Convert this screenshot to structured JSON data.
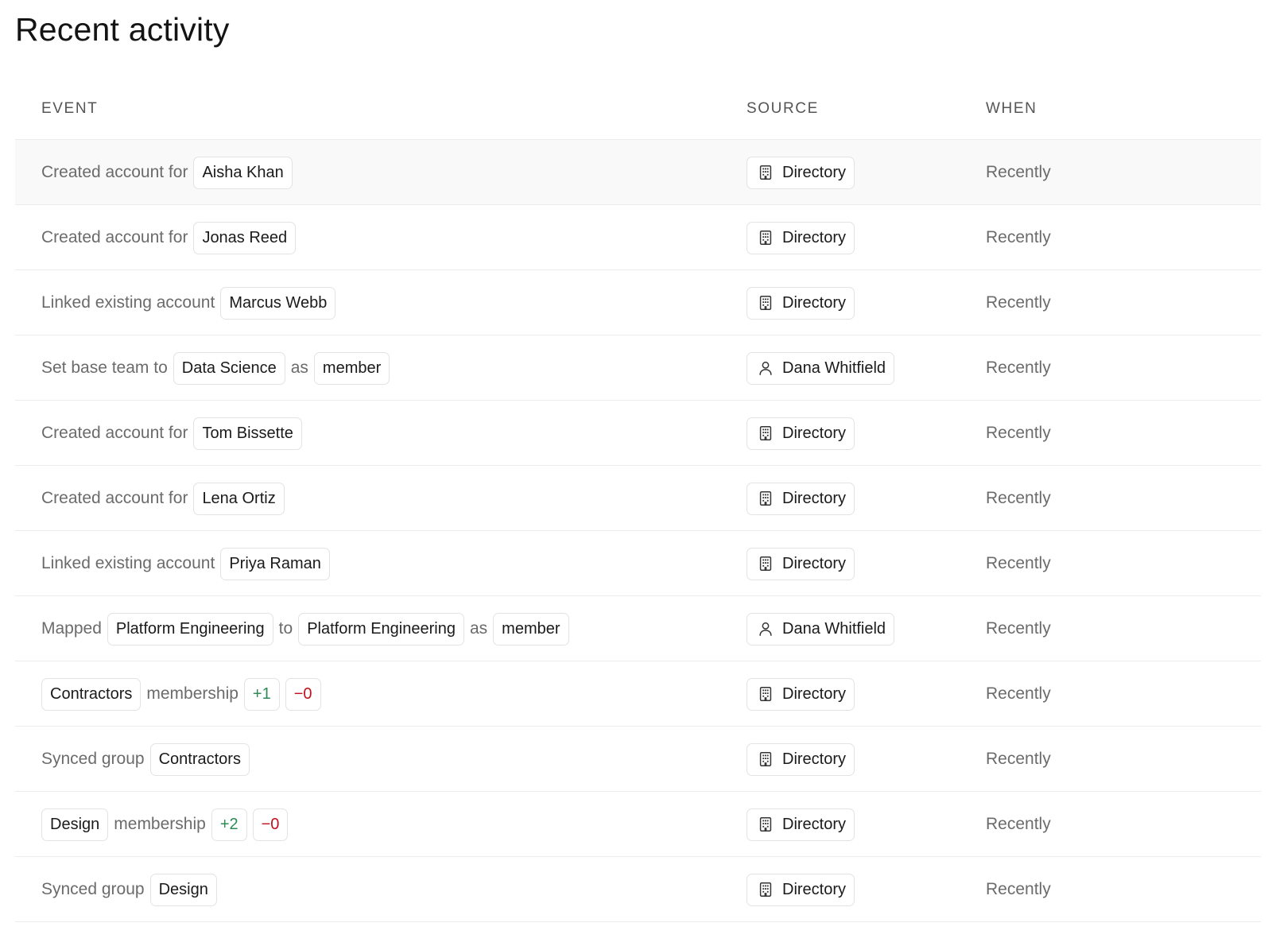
{
  "page": {
    "title": "Recent activity"
  },
  "table": {
    "headers": {
      "event": "EVENT",
      "source": "SOURCE",
      "when": "WHEN"
    },
    "rows": [
      {
        "parts": [
          {
            "t": "text",
            "v": "Created account for"
          },
          {
            "t": "chip",
            "v": "Aisha Khan"
          }
        ],
        "source": {
          "icon": "building-icon",
          "label": "Directory"
        },
        "when": "Recently"
      },
      {
        "parts": [
          {
            "t": "text",
            "v": "Created account for"
          },
          {
            "t": "chip",
            "v": "Jonas Reed"
          }
        ],
        "source": {
          "icon": "building-icon",
          "label": "Directory"
        },
        "when": "Recently"
      },
      {
        "parts": [
          {
            "t": "text",
            "v": "Linked existing account"
          },
          {
            "t": "chip",
            "v": "Marcus Webb"
          }
        ],
        "source": {
          "icon": "building-icon",
          "label": "Directory"
        },
        "when": "Recently"
      },
      {
        "parts": [
          {
            "t": "text",
            "v": "Set base team to"
          },
          {
            "t": "chip",
            "v": "Data Science"
          },
          {
            "t": "text",
            "v": "as"
          },
          {
            "t": "chip",
            "v": "member"
          }
        ],
        "source": {
          "icon": "user-icon",
          "label": "Dana Whitfield"
        },
        "when": "Recently"
      },
      {
        "parts": [
          {
            "t": "text",
            "v": "Created account for"
          },
          {
            "t": "chip",
            "v": "Tom Bissette"
          }
        ],
        "source": {
          "icon": "building-icon",
          "label": "Directory"
        },
        "when": "Recently"
      },
      {
        "parts": [
          {
            "t": "text",
            "v": "Created account for"
          },
          {
            "t": "chip",
            "v": "Lena Ortiz"
          }
        ],
        "source": {
          "icon": "building-icon",
          "label": "Directory"
        },
        "when": "Recently"
      },
      {
        "parts": [
          {
            "t": "text",
            "v": "Linked existing account"
          },
          {
            "t": "chip",
            "v": "Priya Raman"
          }
        ],
        "source": {
          "icon": "building-icon",
          "label": "Directory"
        },
        "when": "Recently"
      },
      {
        "parts": [
          {
            "t": "text",
            "v": "Mapped"
          },
          {
            "t": "chip",
            "v": "Platform Engineering"
          },
          {
            "t": "text",
            "v": "to"
          },
          {
            "t": "chip",
            "v": "Platform Engineering"
          },
          {
            "t": "text",
            "v": "as"
          },
          {
            "t": "chip",
            "v": "member"
          }
        ],
        "source": {
          "icon": "user-icon",
          "label": "Dana Whitfield"
        },
        "when": "Recently"
      },
      {
        "parts": [
          {
            "t": "chip",
            "v": "Contractors"
          },
          {
            "t": "text",
            "v": "membership"
          },
          {
            "t": "plus",
            "v": "+1"
          },
          {
            "t": "minus",
            "v": "−0"
          }
        ],
        "source": {
          "icon": "building-icon",
          "label": "Directory"
        },
        "when": "Recently"
      },
      {
        "parts": [
          {
            "t": "text",
            "v": "Synced group"
          },
          {
            "t": "chip",
            "v": "Contractors"
          }
        ],
        "source": {
          "icon": "building-icon",
          "label": "Directory"
        },
        "when": "Recently"
      },
      {
        "parts": [
          {
            "t": "chip",
            "v": "Design"
          },
          {
            "t": "text",
            "v": "membership"
          },
          {
            "t": "plus",
            "v": "+2"
          },
          {
            "t": "minus",
            "v": "−0"
          }
        ],
        "source": {
          "icon": "building-icon",
          "label": "Directory"
        },
        "when": "Recently"
      },
      {
        "parts": [
          {
            "t": "text",
            "v": "Synced group"
          },
          {
            "t": "chip",
            "v": "Design"
          }
        ],
        "source": {
          "icon": "building-icon",
          "label": "Directory"
        },
        "when": "Recently"
      }
    ]
  },
  "colors": {
    "positive": "#2e8b57",
    "negative": "#c0121e",
    "muted_text": "#6b6b6b"
  }
}
